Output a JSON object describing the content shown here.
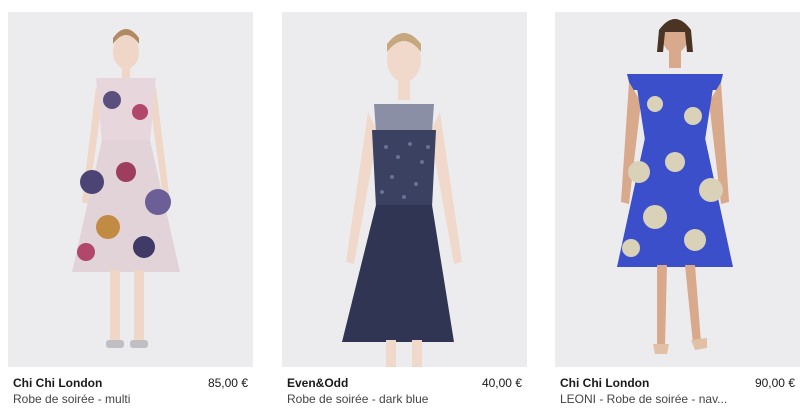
{
  "products": [
    {
      "brand": "Chi Chi London",
      "price": "85,00 €",
      "name": "Robe de soirée - multi",
      "image_alt": "floral-dress-photo"
    },
    {
      "brand": "Even&Odd",
      "price": "40,00 €",
      "name": "Robe de soirée - dark blue",
      "image_alt": "navy-sequin-dress-photo"
    },
    {
      "brand": "Chi Chi London",
      "price": "90,00 €",
      "name": "LEONI - Robe de soirée - nav...",
      "image_alt": "blue-floral-dress-photo"
    }
  ],
  "colors": {
    "dress1": "#d9c9cf",
    "dress2": "#2f3552",
    "dress3": "#3a4fc9"
  }
}
